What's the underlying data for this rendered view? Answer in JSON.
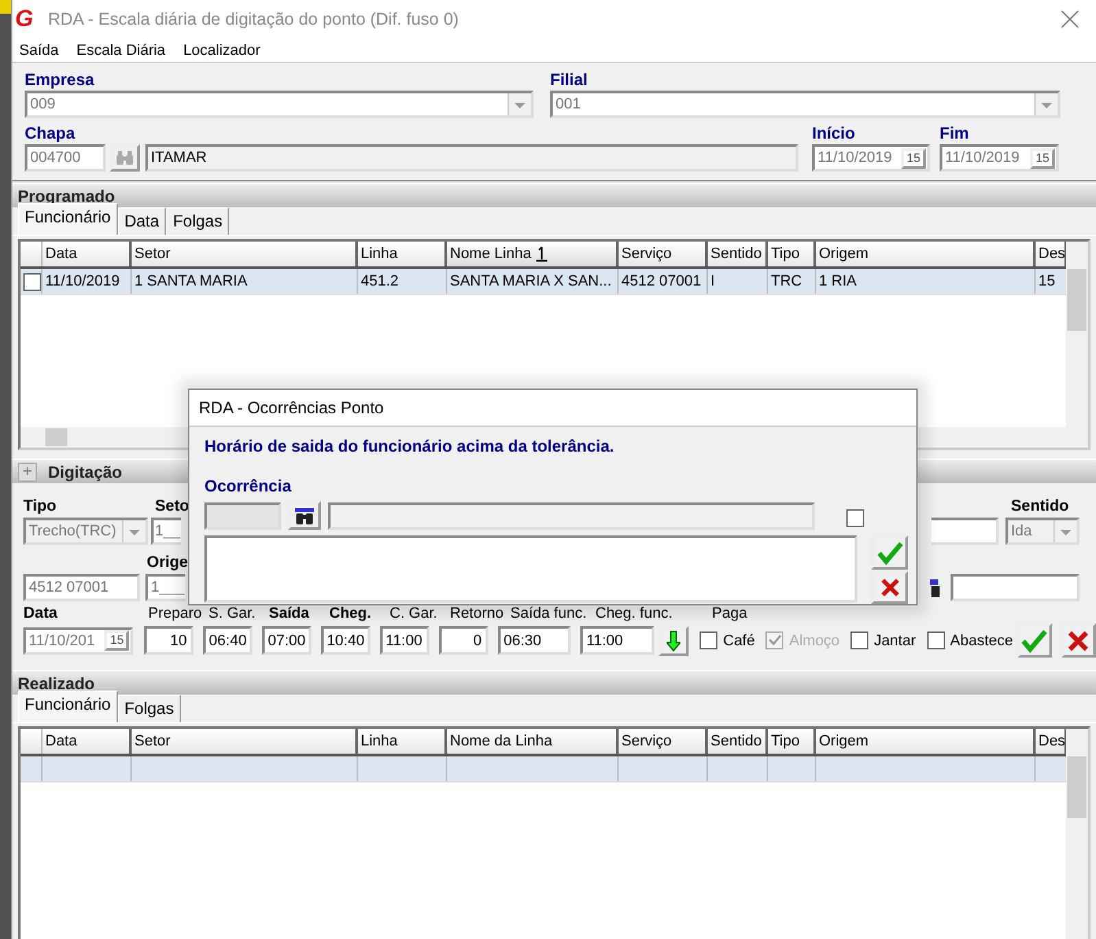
{
  "window": {
    "logo": "G",
    "title": "RDA - Escala diária de digitação do ponto (Dif. fuso 0)"
  },
  "menu": [
    "Saída",
    "Escala Diária",
    "Localizador"
  ],
  "header": {
    "empresa": {
      "label": "Empresa",
      "value": "009"
    },
    "filial": {
      "label": "Filial",
      "value": "001"
    },
    "chapa": {
      "label": "Chapa",
      "value": "004700",
      "name": "ITAMAR"
    },
    "inicio": {
      "label": "Início",
      "value": "11/10/2019",
      "calendar": "15"
    },
    "fim": {
      "label": "Fim",
      "value": "11/10/2019",
      "calendar": "15"
    }
  },
  "programado": {
    "title": "Programado",
    "tabs": [
      {
        "label": "Funcionário",
        "selected": true
      },
      {
        "label": "Data",
        "selected": false
      },
      {
        "label": "Folgas",
        "selected": false
      }
    ],
    "columns": [
      {
        "label": "Data",
        "sorted": false
      },
      {
        "label": "Setor",
        "sorted": false
      },
      {
        "label": "Linha",
        "sorted": false
      },
      {
        "label": "Nome Linha",
        "sorted": true
      },
      {
        "label": "Serviço",
        "sorted": false
      },
      {
        "label": "Sentido",
        "sorted": false
      },
      {
        "label": "Tipo",
        "sorted": false
      },
      {
        "label": "Origem",
        "sorted": false
      },
      {
        "label": "Des",
        "sorted": false
      }
    ],
    "rows": [
      {
        "checked": false,
        "selected": true,
        "cells": [
          "11/10/2019",
          "1 SANTA MARIA",
          "451.2",
          "SANTA MARIA X SAN...",
          "4512 07001",
          "I",
          "TRC",
          "1 RIA",
          "15"
        ]
      }
    ]
  },
  "digitacao": {
    "toggle": "+",
    "title": "Digitação",
    "tipo": {
      "label": "Tipo",
      "value": "Trecho(TRC)"
    },
    "setor": {
      "label": "Seto",
      "value": "1__"
    },
    "sentido": {
      "label": "Sentido",
      "value": "Ida"
    },
    "origem": {
      "label": "Orige",
      "value": "1___"
    },
    "servico": {
      "value": "4512 07001"
    },
    "data": {
      "label": "Data",
      "value": "11/10/201",
      "calendar": "15"
    },
    "times": [
      {
        "label": "Preparo",
        "value": "10",
        "kind": "number",
        "emphasis": false
      },
      {
        "label": "S. Gar.",
        "value": "06:40",
        "kind": "time",
        "emphasis": false
      },
      {
        "label": "Saída",
        "value": "07:00",
        "kind": "time",
        "emphasis": true
      },
      {
        "label": "Cheg.",
        "value": "10:40",
        "kind": "time",
        "emphasis": true
      },
      {
        "label": "C. Gar.",
        "value": "11:00",
        "kind": "time",
        "emphasis": false
      },
      {
        "label": "Retorno",
        "value": "0",
        "kind": "number",
        "emphasis": false
      },
      {
        "label": "Saída func.",
        "value": "06:30",
        "kind": "time",
        "emphasis": false
      },
      {
        "label": "Cheg. func.",
        "value": "11:00",
        "kind": "time",
        "emphasis": false
      }
    ],
    "paga": {
      "label": "Paga",
      "options": [
        {
          "label": "Café",
          "checked": false,
          "disabled": false
        },
        {
          "label": "Almoço",
          "checked": true,
          "disabled": true
        },
        {
          "label": "Jantar",
          "checked": false,
          "disabled": false
        },
        {
          "label": "Abastece",
          "checked": false,
          "disabled": false
        }
      ]
    }
  },
  "realizado": {
    "title": "Realizado",
    "tabs": [
      {
        "label": "Funcionário",
        "selected": true
      },
      {
        "label": "Folgas",
        "selected": false
      }
    ],
    "columns": [
      "Data",
      "Setor",
      "Linha",
      "Nome da Linha",
      "Serviço",
      "Sentido",
      "Tipo",
      "Origem",
      "Des"
    ],
    "rows": [
      {
        "selected": true
      }
    ]
  },
  "dialog": {
    "title": "RDA - Ocorrências Ponto",
    "message": "Horário de saida do funcionário acima da tolerância.",
    "label": "Ocorrência",
    "checked": false
  }
}
